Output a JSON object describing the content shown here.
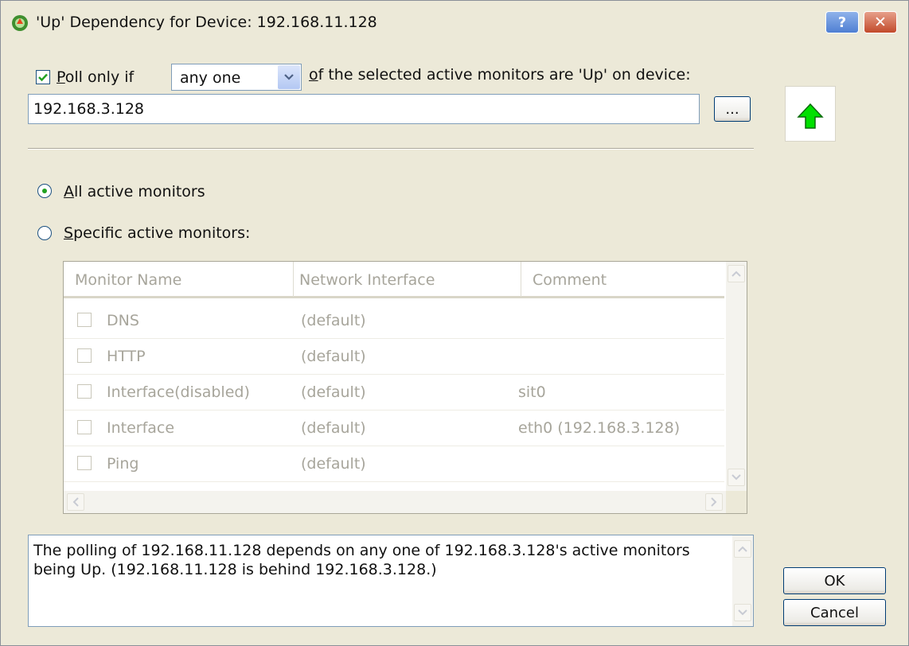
{
  "window": {
    "title": "'Up' Dependency for Device: 192.168.11.128"
  },
  "poll": {
    "checkbox_checked": true,
    "label_prefix": "oll only if",
    "label_underline_letter": "P",
    "condition_value": "any one",
    "label_suffix_underlined": "o",
    "label_suffix": "f the selected active monitors are 'Up' on device:"
  },
  "device": {
    "value": "192.168.3.128",
    "browse_label": "..."
  },
  "status_icon": "green-up-arrow-icon",
  "radios": {
    "all": {
      "underline": "A",
      "rest": "ll active monitors",
      "selected": true
    },
    "specific": {
      "underline": "S",
      "rest": "pecific active monitors:",
      "selected": false
    }
  },
  "table": {
    "columns": [
      "Monitor Name",
      "Network Interface",
      "Comment"
    ],
    "rows": [
      {
        "name": "DNS",
        "interface": "(default)",
        "comment": ""
      },
      {
        "name": "HTTP",
        "interface": "(default)",
        "comment": ""
      },
      {
        "name": "Interface(disabled)",
        "interface": "(default)",
        "comment": "sit0"
      },
      {
        "name": "Interface",
        "interface": "(default)",
        "comment": "eth0 (192.168.3.128)"
      },
      {
        "name": "Ping",
        "interface": "(default)",
        "comment": ""
      }
    ]
  },
  "description": "The polling of 192.168.11.128 depends on any one of 192.168.3.128's active monitors being Up.  (192.168.11.128 is behind 192.168.3.128.)",
  "buttons": {
    "ok": "OK",
    "cancel": "Cancel"
  },
  "colors": {
    "accent_green": "#00e000",
    "title_close": "#c24a2b"
  }
}
